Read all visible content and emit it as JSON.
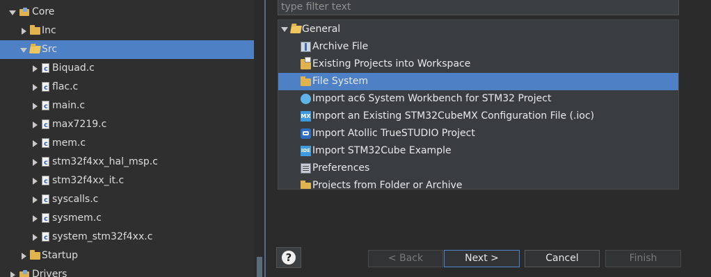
{
  "explorer": {
    "items": [
      {
        "label": "Core",
        "kind": "package",
        "state": "expanded",
        "selected": false
      },
      {
        "label": "Inc",
        "kind": "folder",
        "state": "collapsed",
        "selected": false
      },
      {
        "label": "Src",
        "kind": "folder-open",
        "state": "expanded",
        "selected": true
      },
      {
        "label": "Biquad.c",
        "kind": "cfile",
        "state": "collapsed",
        "selected": false
      },
      {
        "label": "flac.c",
        "kind": "cfile",
        "state": "collapsed",
        "selected": false
      },
      {
        "label": "main.c",
        "kind": "cfile",
        "state": "collapsed",
        "selected": false
      },
      {
        "label": "max7219.c",
        "kind": "cfile",
        "state": "collapsed",
        "selected": false
      },
      {
        "label": "mem.c",
        "kind": "cfile",
        "state": "collapsed",
        "selected": false
      },
      {
        "label": "stm32f4xx_hal_msp.c",
        "kind": "cfile",
        "state": "collapsed",
        "selected": false
      },
      {
        "label": "stm32f4xx_it.c",
        "kind": "cfile",
        "state": "collapsed",
        "selected": false
      },
      {
        "label": "syscalls.c",
        "kind": "cfile",
        "state": "collapsed",
        "selected": false
      },
      {
        "label": "sysmem.c",
        "kind": "cfile",
        "state": "collapsed",
        "selected": false
      },
      {
        "label": "system_stm32f4xx.c",
        "kind": "cfile",
        "state": "collapsed",
        "selected": false
      },
      {
        "label": "Startup",
        "kind": "folder",
        "state": "collapsed",
        "selected": false
      },
      {
        "label": "Drivers",
        "kind": "package",
        "state": "collapsed",
        "selected": false
      }
    ]
  },
  "dialog": {
    "filter": {
      "placeholder": "type filter text",
      "value": ""
    },
    "tree": {
      "group": {
        "label": "General",
        "icon": "folder-open-icon"
      },
      "items": [
        {
          "label": "Archive File",
          "icon": "archive-file-icon",
          "selected": false
        },
        {
          "label": "Existing Projects into Workspace",
          "icon": "existing-projects-icon",
          "selected": false
        },
        {
          "label": "File System",
          "icon": "folder-icon",
          "selected": true
        },
        {
          "label": "Import ac6 System Workbench for STM32 Project",
          "icon": "ac6-workbench-icon",
          "selected": false
        },
        {
          "label": "Import an Existing STM32CubeMX Configuration File (.ioc)",
          "icon": "cubemx-icon",
          "selected": false
        },
        {
          "label": "Import Atollic TrueSTUDIO Project",
          "icon": "atollic-icon",
          "selected": false
        },
        {
          "label": "Import STM32Cube Example",
          "icon": "stm32cube-ide-icon",
          "selected": false
        },
        {
          "label": "Preferences",
          "icon": "preferences-icon",
          "selected": false
        },
        {
          "label": "Projects from Folder or Archive",
          "icon": "folder-icon",
          "selected": false
        }
      ]
    },
    "buttons": {
      "help": "?",
      "back": "< Back",
      "next": "Next >",
      "cancel": "Cancel",
      "finish": "Finish"
    }
  },
  "colors": {
    "selection": "#4e80c6",
    "background": "#2b2b2b",
    "default_button_border": "#4f86cf"
  }
}
